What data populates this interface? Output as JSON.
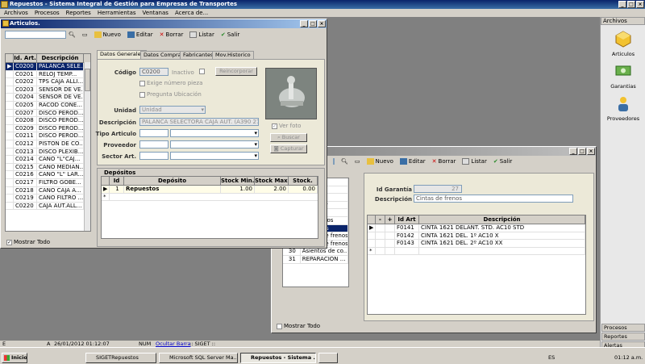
{
  "app": {
    "title": "Repuestos - Sistema Integral de Gestión para Empresas de Transportes",
    "menu": [
      "Archivos",
      "Procesos",
      "Reportes",
      "Herramientas",
      "Ventanas",
      "Acerca de..."
    ]
  },
  "articulos": {
    "title": "Articulos.",
    "toolbar": {
      "nuevo": "Nuevo",
      "editar": "Editar",
      "borrar": "Borrar",
      "listar": "Listar",
      "salir": "Salir"
    },
    "columns": [
      "Id. Art.",
      "Descripción"
    ],
    "rows": [
      [
        "C0200",
        "PALANCA SELE..."
      ],
      [
        "C0201",
        "RELOJ TEMP..."
      ],
      [
        "C0202",
        "TPS CAJA ALLI..."
      ],
      [
        "C0203",
        "SENSOR DE VE..."
      ],
      [
        "C0204",
        "SENSOR DE VE..."
      ],
      [
        "C0205",
        "RACOD CONE..."
      ],
      [
        "C0207",
        "DISCO PEROD..."
      ],
      [
        "C0208",
        "DISCO PEROD..."
      ],
      [
        "C0209",
        "DISCO PEROD..."
      ],
      [
        "C0211",
        "DISCO PEROD..."
      ],
      [
        "C0212",
        "PISTON DE CO..."
      ],
      [
        "C0213",
        "DISCO PLEXIB..."
      ],
      [
        "C0214",
        "CAÑO \"L\"CAJ..."
      ],
      [
        "C0215",
        "CAÑO MEDIAN..."
      ],
      [
        "C0216",
        "CAÑO \"L\" LAR..."
      ],
      [
        "C0217",
        "FILTRO GOBE..."
      ],
      [
        "C0218",
        "CAÑO CAJA A..."
      ],
      [
        "C0219",
        "CAÑO FILTRO ..."
      ],
      [
        "C0220",
        "CAJA AUT.ALL..."
      ]
    ],
    "mostrar_todo": "Mostrar Todo",
    "tabs": [
      "Datos Generales",
      "Datos Compras",
      "Fabricantes",
      "Mov.Historico"
    ],
    "codigo_label": "Código",
    "codigo_value": "C0200",
    "inactivo_label": "Inactivo",
    "recorporar_label": "Reincorporar",
    "exige_label": "Exige número pieza",
    "pregunta_label": "Pregunta Ubicación",
    "unidad_label": "Unidad",
    "unidad_value": "Unidad",
    "descripcion_label": "Descripción",
    "descripcion_value": "PALANCA SELECTORA CAJA AUT. (A390 270 71 52)",
    "tipo_label": "Tipo Articulo",
    "proveedor_label": "Proveedor",
    "sector_label": "Sector Art.",
    "ver_foto": "Ver foto",
    "buscar": "Buscar",
    "capturar": "Capturar",
    "depositos_title": "Depósitos",
    "dep_columns": [
      "Id",
      "Depósito",
      "Stock Min.",
      "Stock Max.",
      "Stock."
    ],
    "dep_row": [
      "1",
      "Repuestos",
      "1.00",
      "2.00",
      "0.00"
    ]
  },
  "garantias": {
    "toolbar": {
      "nuevo": "Nuevo",
      "editar": "Editar",
      "borrar": "Borrar",
      "listar": "Listar",
      "salir": "Salir"
    },
    "left_rows": [
      [
        "",
        "LES"
      ],
      [
        "",
        "dador ..."
      ],
      [
        "",
        "dador ..."
      ],
      [
        "",
        "dor Inoor"
      ],
      [
        "",
        "dor Kn..."
      ],
      [
        "",
        "s de frenos"
      ],
      [
        "",
        "de frenos"
      ],
      [
        "28",
        "Cintas de frenos"
      ],
      [
        "29",
        "Cintas de frenos"
      ],
      [
        "30",
        "Asientos de co..."
      ],
      [
        "31",
        "REPARACION ..."
      ]
    ],
    "id_label": "Id Garantía",
    "id_value": "27",
    "desc_label": "Descripción",
    "desc_value": "Cintas de frenos",
    "detail_columns": [
      "-",
      "+",
      "Id Art",
      "Descripción"
    ],
    "detail_rows": [
      [
        "F0141",
        "CINTA 1621 DELANT. STD. AC10 STD"
      ],
      [
        "F0142",
        "CINTA 1621 DEL. 1º AC10 X"
      ],
      [
        "F0143",
        "CINTA 1621 DEL. 2º AC10 XX"
      ]
    ],
    "mostrar_todo": "Mostrar Todo"
  },
  "right_panel": {
    "header": "Archivos",
    "items": [
      "Articulos",
      "Garantias",
      "Proveedores"
    ],
    "tabs": [
      "Procesos",
      "Reportes",
      "Alertas"
    ]
  },
  "statusbar": {
    "e": "E",
    "a": "A",
    "datetime": "26/01/2012 01:12:07",
    "num": "NUM",
    "ocultar": "Ocultar Barra",
    "siget": ":: SIGET ::"
  },
  "taskbar": {
    "start": "Inicio",
    "tasks": [
      "SIGETRepuestos",
      "Microsoft SQL Server Ma...",
      "Repuestos - Sistema ...",
      ""
    ],
    "lang": "ES",
    "time": "01:12 a.m."
  }
}
